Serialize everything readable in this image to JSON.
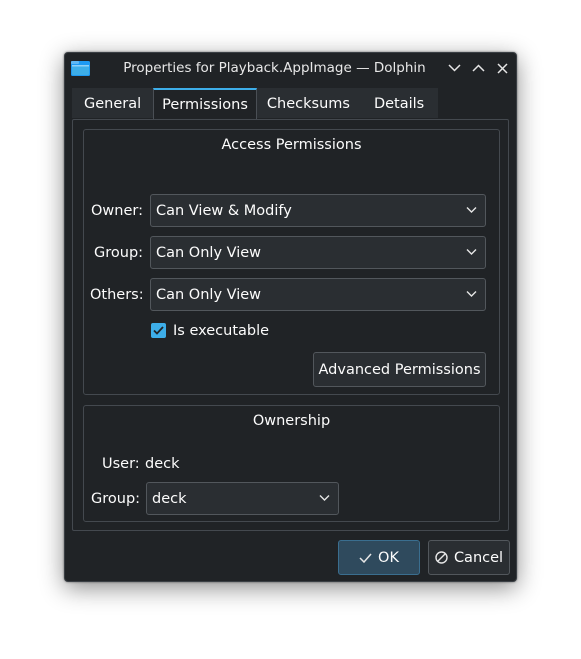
{
  "window": {
    "title": "Properties for Playback.AppImage — Dolphin"
  },
  "tabs": [
    {
      "label": "General",
      "active": false
    },
    {
      "label": "Permissions",
      "active": true
    },
    {
      "label": "Checksums",
      "active": false
    },
    {
      "label": "Details",
      "active": false
    }
  ],
  "access": {
    "title": "Access Permissions",
    "owner": {
      "label": "Owner:",
      "value": "Can View & Modify"
    },
    "group": {
      "label": "Group:",
      "value": "Can Only View"
    },
    "others": {
      "label": "Others:",
      "value": "Can Only View"
    },
    "executable": {
      "label": "Is executable",
      "checked": true
    },
    "advanced_label": "Advanced Permissions"
  },
  "ownership": {
    "title": "Ownership",
    "user_label": "User:",
    "user_value": "deck",
    "group_label": "Group:",
    "group_value": "deck"
  },
  "buttons": {
    "ok": "OK",
    "cancel": "Cancel"
  },
  "colors": {
    "accent": "#3daee9",
    "window_bg": "#202326"
  }
}
